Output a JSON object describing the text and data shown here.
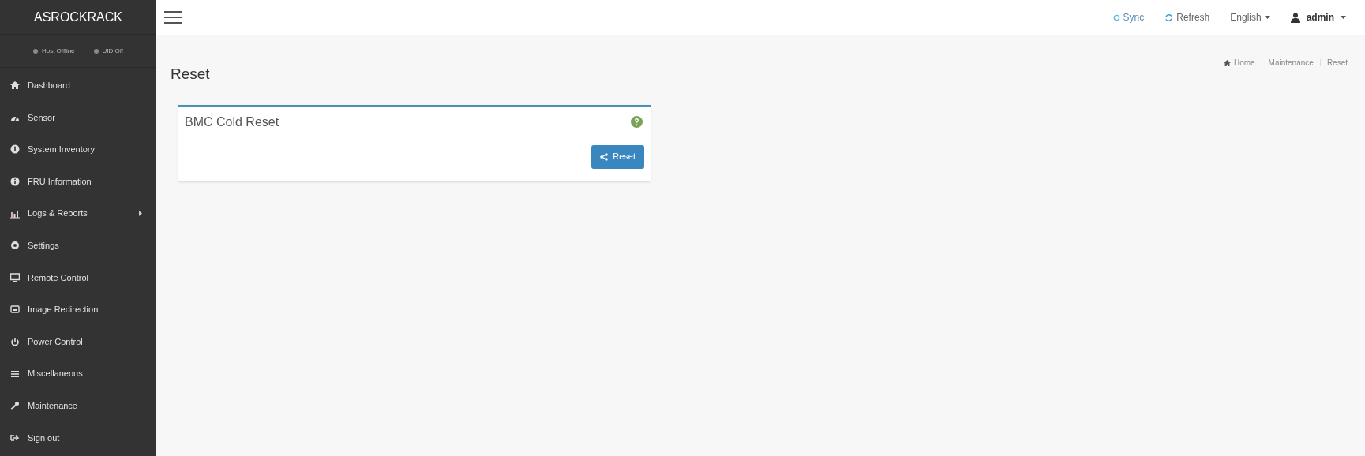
{
  "brand": "ASROCKRACK",
  "status": [
    {
      "label": "Host Offline",
      "color": "#8a8a8a"
    },
    {
      "label": "UID Off",
      "color": "#8a8a8a"
    }
  ],
  "sidebar": {
    "items": [
      {
        "label": "Dashboard",
        "submenu": false
      },
      {
        "label": "Sensor",
        "submenu": false
      },
      {
        "label": "System Inventory",
        "submenu": false
      },
      {
        "label": "FRU Information",
        "submenu": false
      },
      {
        "label": "Logs & Reports",
        "submenu": true
      },
      {
        "label": "Settings",
        "submenu": false
      },
      {
        "label": "Remote Control",
        "submenu": false
      },
      {
        "label": "Image Redirection",
        "submenu": false
      },
      {
        "label": "Power Control",
        "submenu": false
      },
      {
        "label": "Miscellaneous",
        "submenu": false
      },
      {
        "label": "Maintenance",
        "submenu": false
      },
      {
        "label": "Sign out",
        "submenu": false
      }
    ]
  },
  "topbar": {
    "sync": "Sync",
    "refresh": "Refresh",
    "language": "English",
    "user": "admin"
  },
  "page_title": "Reset",
  "breadcrumb": [
    "Home",
    "Maintenance",
    "Reset"
  ],
  "card": {
    "title": "BMC Cold Reset",
    "button": "Reset"
  }
}
